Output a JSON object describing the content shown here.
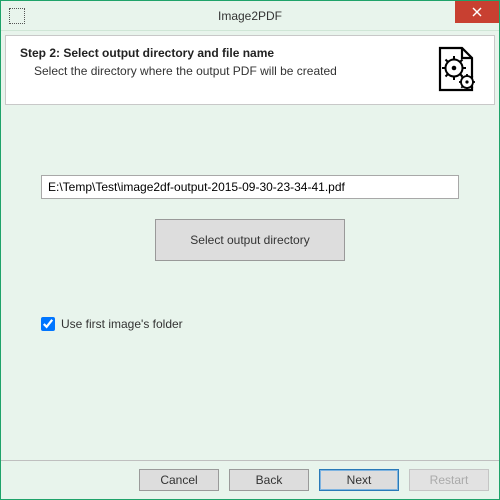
{
  "window": {
    "title": "Image2PDF"
  },
  "header": {
    "step_title": "Step 2: Select output directory and file name",
    "step_desc": "Select the directory where the output PDF will be created"
  },
  "form": {
    "output_path": "E:\\Temp\\Test\\image2df-output-2015-09-30-23-34-41.pdf",
    "select_button": "Select output directory",
    "use_first_folder_label": "Use first image's folder",
    "use_first_folder_checked": true
  },
  "footer": {
    "cancel": "Cancel",
    "back": "Back",
    "next": "Next",
    "restart": "Restart"
  }
}
